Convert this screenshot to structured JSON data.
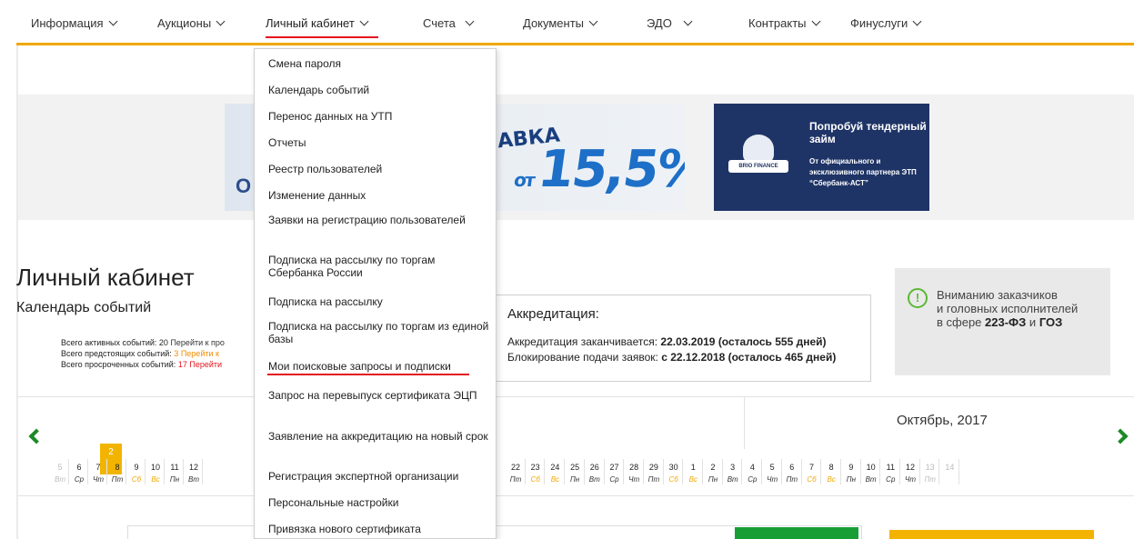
{
  "nav": {
    "items": [
      "Информация",
      "Аукционы",
      "Личный кабинет",
      "Счета",
      "Документы",
      "ЭДО",
      "Контракты",
      "Финуслуги"
    ],
    "active": "Личный кабинет"
  },
  "dropdown": {
    "items": [
      "Смена пароля",
      "Календарь событий",
      "Перенос данных на УТП",
      "Отчеты",
      "Реестр пользователей",
      "Изменение данных",
      "Заявки на регистрацию пользователей",
      "Подписка на рассылку по торгам Сбербанка России",
      "Подписка на рассылку",
      "Подписка на рассылку по торгам из единой базы",
      "Мои поисковые запросы и подписки",
      "Запрос на перевыпуск сертификата ЭЦП",
      "Заявление на аккредитацию на новый срок",
      "Регистрация экспертной организации",
      "Персональные настройки",
      "Привязка нового сертификата"
    ],
    "highlighted": "Мои поисковые запросы и подписки"
  },
  "banners": {
    "rate": {
      "fragment_left": "О",
      "fragment_top": "АВКА",
      "prefix": "от",
      "value": "15,5%"
    },
    "loan": {
      "logo_text": "BRIO FINANCE",
      "title": "Попробуй тендерный займ",
      "subtitle": "От официального и эксклюзивного партнера ЭТП “Сбербанк-АСТ”"
    }
  },
  "page": {
    "title": "Личный кабинет",
    "subtitle": "Календарь событий",
    "stats": [
      {
        "label": "Всего активных событий: 20",
        "link": "Перейти к про"
      },
      {
        "label": "Всего предстоящих событий:",
        "count": "3",
        "link": "Перейти к"
      },
      {
        "label": "Всего просроченных событий:",
        "count": "17",
        "link": "Перейти"
      }
    ]
  },
  "accreditation": {
    "title": "Аккредитация:",
    "expires_label": "Аккредитация заканчивается:",
    "expires_value": "22.03.2019 (осталось 555 дней)",
    "block_label": "Блокирование подачи заявок:",
    "block_value": "с 22.12.2018 (осталось 465 дней)"
  },
  "notice": {
    "icon": "exclamation-circle-icon",
    "line1": "Вниманию заказчиков",
    "line2": "и головных исполнителей",
    "line3_prefix": "в сфере",
    "highlight1": "223-ФЗ",
    "conj": "и",
    "highlight2": "ГОЗ"
  },
  "calendar": {
    "month": "Октябрь, 2017",
    "today_marker": "2",
    "left_days": [
      {
        "d": "5",
        "w": "Вт",
        "dim": true
      },
      {
        "d": "6",
        "w": "Ср"
      },
      {
        "d": "7",
        "w": "Чт",
        "today": true
      },
      {
        "d": "8",
        "w": "Пт"
      },
      {
        "d": "9",
        "w": "Сб",
        "we": true
      },
      {
        "d": "10",
        "w": "Вс",
        "we": true
      },
      {
        "d": "11",
        "w": "Пн"
      },
      {
        "d": "12",
        "w": "Вт"
      }
    ],
    "right_days": [
      {
        "d": "22",
        "w": "Пт"
      },
      {
        "d": "23",
        "w": "Сб",
        "we": true
      },
      {
        "d": "24",
        "w": "Вс",
        "we": true
      },
      {
        "d": "25",
        "w": "Пн"
      },
      {
        "d": "26",
        "w": "Вт"
      },
      {
        "d": "27",
        "w": "Ср"
      },
      {
        "d": "28",
        "w": "Чт"
      },
      {
        "d": "29",
        "w": "Пт"
      },
      {
        "d": "30",
        "w": "Сб",
        "we": true
      },
      {
        "d": "1",
        "w": "Вс",
        "we": true
      },
      {
        "d": "2",
        "w": "Пн"
      },
      {
        "d": "3",
        "w": "Вт"
      },
      {
        "d": "4",
        "w": "Ср"
      },
      {
        "d": "5",
        "w": "Чт"
      },
      {
        "d": "6",
        "w": "Пт"
      },
      {
        "d": "7",
        "w": "Сб",
        "we": true
      },
      {
        "d": "8",
        "w": "Вс",
        "we": true
      },
      {
        "d": "9",
        "w": "Пн"
      },
      {
        "d": "10",
        "w": "Вт"
      },
      {
        "d": "11",
        "w": "Ср"
      },
      {
        "d": "12",
        "w": "Чт"
      },
      {
        "d": "13",
        "w": "Пт",
        "dim": true
      },
      {
        "d": "14",
        "w": "",
        "dim": true
      }
    ]
  },
  "colors": {
    "accent": "#f0a800",
    "red": "#e3141d",
    "green": "#1c8a26",
    "navy": "#1f3466"
  }
}
